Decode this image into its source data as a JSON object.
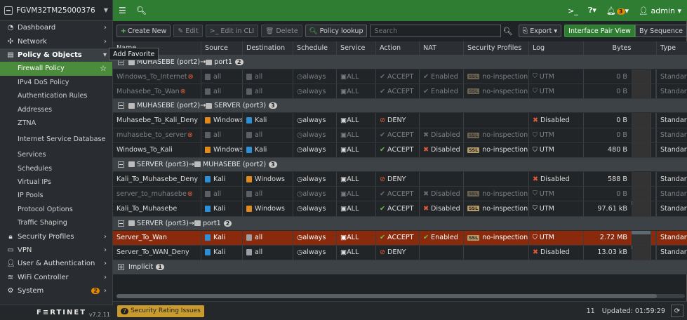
{
  "device": {
    "name": "FGVM32TM25000376"
  },
  "sidebar": {
    "items": [
      {
        "label": "Dashboard",
        "icon": "dashboard-icon"
      },
      {
        "label": "Network",
        "icon": "network-icon"
      },
      {
        "label": "Policy & Objects",
        "icon": "policy-icon"
      },
      {
        "label": "Firewall Policy"
      },
      {
        "label": "IPv4 DoS Policy"
      },
      {
        "label": "Authentication Rules"
      },
      {
        "label": "Addresses"
      },
      {
        "label": "ZTNA"
      },
      {
        "label": "Internet Service Database"
      },
      {
        "label": "Services"
      },
      {
        "label": "Schedules"
      },
      {
        "label": "Virtual IPs"
      },
      {
        "label": "IP Pools"
      },
      {
        "label": "Protocol Options"
      },
      {
        "label": "Traffic Shaping"
      },
      {
        "label": "Security Profiles",
        "icon": "lock-icon"
      },
      {
        "label": "VPN",
        "icon": "monitor-icon"
      },
      {
        "label": "User & Authentication",
        "icon": "user-icon"
      },
      {
        "label": "WiFi Controller",
        "icon": "wifi-icon"
      },
      {
        "label": "System",
        "icon": "gear-icon",
        "badge": "2"
      }
    ],
    "brand": "F≡RTINET",
    "version": "v7.2.11"
  },
  "topbar": {
    "notif_count": "3",
    "user": "admin"
  },
  "tooltip": "Add Favorite",
  "toolbar": {
    "create": "Create New",
    "edit": "Edit",
    "edit_cli": "Edit in CLI",
    "delete": "Delete",
    "lookup": "Policy lookup",
    "search_placeholder": "Search",
    "export": "Export",
    "view_pair": "Interface Pair View",
    "view_seq": "By Sequence"
  },
  "columns": [
    "Name",
    "Source",
    "Destination",
    "Schedule",
    "Service",
    "Action",
    "NAT",
    "Security Profiles",
    "Log",
    "Bytes",
    "Type"
  ],
  "groups": [
    {
      "src": "MUHASEBE (port2)",
      "dst": "port1",
      "count": "2",
      "rows": [
        {
          "name": "Windows_To_Internet",
          "off": true,
          "src": "all",
          "srcIcon": "gr",
          "dst": "all",
          "dstIcon": "gr",
          "sched": "always",
          "svc": "ALL",
          "action": "ACCEPT",
          "nat": "Enabled",
          "prof": "no-inspection",
          "log": "UTM",
          "bytes": "0 B",
          "bar": 0,
          "type": "Standard"
        },
        {
          "name": "Muhasebe_To_Wan",
          "off": true,
          "src": "all",
          "srcIcon": "gr",
          "dst": "all",
          "dstIcon": "gr",
          "sched": "always",
          "svc": "ALL",
          "action": "ACCEPT",
          "nat": "Enabled",
          "prof": "no-inspection",
          "log": "UTM",
          "bytes": "0 B",
          "bar": 0,
          "type": "Standard"
        }
      ]
    },
    {
      "src": "MUHASEBE (port2)",
      "dst": "SERVER (port3)",
      "count": "3",
      "rows": [
        {
          "name": "Muhasebe_To_Kali_Deny",
          "off": false,
          "src": "Windows",
          "srcIcon": "org",
          "dst": "Kali",
          "dstIcon": "blu",
          "sched": "always",
          "svc": "ALL",
          "action": "DENY",
          "nat": "",
          "prof": "",
          "log": "Disabled",
          "bytes": "0 B",
          "bar": 0,
          "type": "Standard"
        },
        {
          "name": "muhasebe_to_server",
          "off": true,
          "src": "all",
          "srcIcon": "gr",
          "dst": "all",
          "dstIcon": "gr",
          "sched": "always",
          "svc": "ALL",
          "action": "ACCEPT",
          "nat": "Disabled",
          "prof": "no-inspection",
          "log": "UTM",
          "bytes": "0 B",
          "bar": 0,
          "type": "Standard"
        },
        {
          "name": "Windows_To_Kali",
          "off": false,
          "src": "Windows",
          "srcIcon": "org",
          "dst": "Kali",
          "dstIcon": "blu",
          "sched": "always",
          "svc": "ALL",
          "action": "ACCEPT",
          "nat": "Disabled",
          "prof": "no-inspection",
          "log": "UTM",
          "bytes": "480 B",
          "bar": 0,
          "type": "Standard"
        }
      ]
    },
    {
      "src": "SERVER (port3)",
      "dst": "MUHASEBE (port2)",
      "count": "3",
      "rows": [
        {
          "name": "Kali_To_Muhasebe_Deny",
          "off": false,
          "src": "Kali",
          "srcIcon": "blu",
          "dst": "Windows",
          "dstIcon": "org",
          "sched": "always",
          "svc": "ALL",
          "action": "DENY",
          "nat": "",
          "prof": "",
          "log": "Disabled",
          "bytes": "588 B",
          "bar": 0,
          "type": "Standard"
        },
        {
          "name": "server_to_muhasebe",
          "off": true,
          "src": "all",
          "srcIcon": "gr",
          "dst": "all",
          "dstIcon": "gr",
          "sched": "always",
          "svc": "ALL",
          "action": "ACCEPT",
          "nat": "Disabled",
          "prof": "no-inspection",
          "log": "UTM",
          "bytes": "0 B",
          "bar": 0,
          "type": "Standard"
        },
        {
          "name": "Kali_To_Muhasebe",
          "off": false,
          "src": "Kali",
          "srcIcon": "blu",
          "dst": "Windows",
          "dstIcon": "org",
          "sched": "always",
          "svc": "ALL",
          "action": "ACCEPT",
          "nat": "Disabled",
          "prof": "no-inspection",
          "log": "UTM",
          "bytes": "97.61 kB",
          "bar": 0.03,
          "type": "Standard"
        }
      ]
    },
    {
      "src": "SERVER (port3)",
      "dst": "port1",
      "count": "2",
      "rows": [
        {
          "name": "Server_To_Wan",
          "off": false,
          "sel": true,
          "src": "Kali",
          "srcIcon": "blu",
          "dst": "all",
          "dstIcon": "gr",
          "sched": "always",
          "svc": "ALL",
          "action": "ACCEPT",
          "nat": "Enabled",
          "prof": "no-inspection",
          "log": "UTM",
          "bytes": "2.72 MB",
          "bar": 1,
          "type": "Standard"
        },
        {
          "name": "Server_To_WAN_Deny",
          "off": false,
          "src": "Kali",
          "srcIcon": "blu",
          "dst": "all",
          "dstIcon": "gr",
          "sched": "always",
          "svc": "ALL",
          "action": "DENY",
          "nat": "",
          "prof": "",
          "log": "Disabled",
          "bytes": "13.03 kB",
          "bar": 0.005,
          "type": "Standard"
        }
      ]
    }
  ],
  "implicit": {
    "label": "Implicit",
    "count": "1"
  },
  "status": {
    "rating_count": "7",
    "rating_label": "Security Rating Issues",
    "count": "11",
    "updated": "Updated: 01:59:29"
  }
}
